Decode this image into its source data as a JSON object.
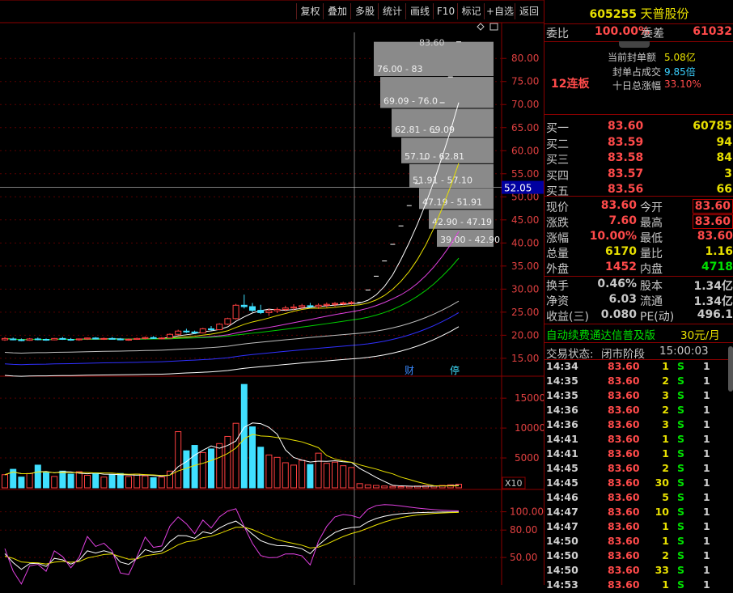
{
  "toolbar": {
    "buttons": [
      "复权",
      "叠加",
      "多股",
      "统计",
      "画线",
      "F10",
      "标记",
      "+自选",
      "返回"
    ]
  },
  "stock": {
    "code": "605255",
    "name": "天普股份"
  },
  "commission": {
    "ratio_label": "委比",
    "ratio_value": "100.00%",
    "diff_label": "委差",
    "diff_value": "61032"
  },
  "limit_info": {
    "streak": "12连板",
    "seal_amount_label": "当前封单额",
    "seal_amount_value": "5.08亿",
    "seal_ratio_label": "封单占成交",
    "seal_ratio_value": "9.85倍",
    "ten_day_label": "十日总涨幅",
    "ten_day_value": "33.10%"
  },
  "bids": [
    {
      "label": "买一",
      "price": "83.60",
      "vol": "60785"
    },
    {
      "label": "买二",
      "price": "83.59",
      "vol": "94"
    },
    {
      "label": "买三",
      "price": "83.58",
      "vol": "84"
    },
    {
      "label": "买四",
      "price": "83.57",
      "vol": "3"
    },
    {
      "label": "买五",
      "price": "83.56",
      "vol": "66"
    }
  ],
  "quote": {
    "rows": [
      [
        "现价",
        "83.60",
        "今开",
        "83.60"
      ],
      [
        "涨跌",
        "7.60",
        "最高",
        "83.60"
      ],
      [
        "涨幅",
        "10.00%",
        "最低",
        "83.60"
      ],
      [
        "总量",
        "6170",
        "量比",
        "1.16"
      ],
      [
        "外盘",
        "1452",
        "内盘",
        "4718"
      ]
    ],
    "rows2": [
      [
        "换手",
        "0.46%",
        "股本",
        "1.34亿"
      ],
      [
        "净资",
        "6.03",
        "流通",
        "1.34亿"
      ],
      [
        "收益(三)",
        "0.080",
        "PE(动)",
        "496.1"
      ]
    ]
  },
  "ad": {
    "text": "自动续费通达信普及版",
    "price": "30元/月"
  },
  "trade_status": {
    "label": "交易状态:",
    "value": "闭市阶段",
    "time": "15:00:03"
  },
  "ticks": [
    [
      "14:34",
      "83.60",
      "1",
      "S",
      "1"
    ],
    [
      "14:35",
      "83.60",
      "2",
      "S",
      "1"
    ],
    [
      "14:35",
      "83.60",
      "3",
      "S",
      "1"
    ],
    [
      "14:36",
      "83.60",
      "2",
      "S",
      "1"
    ],
    [
      "14:36",
      "83.60",
      "3",
      "S",
      "1"
    ],
    [
      "14:41",
      "83.60",
      "1",
      "S",
      "1"
    ],
    [
      "14:41",
      "83.60",
      "1",
      "S",
      "1"
    ],
    [
      "14:45",
      "83.60",
      "2",
      "S",
      "1"
    ],
    [
      "14:45",
      "83.60",
      "30",
      "S",
      "1"
    ],
    [
      "14:46",
      "83.60",
      "5",
      "S",
      "1"
    ],
    [
      "14:47",
      "83.60",
      "10",
      "S",
      "1"
    ],
    [
      "14:47",
      "83.60",
      "1",
      "S",
      "1"
    ],
    [
      "14:50",
      "83.60",
      "1",
      "S",
      "1"
    ],
    [
      "14:50",
      "83.60",
      "2",
      "S",
      "1"
    ],
    [
      "14:50",
      "83.60",
      "33",
      "S",
      "1"
    ],
    [
      "14:53",
      "83.60",
      "1",
      "S",
      "1"
    ]
  ],
  "chart_data": {
    "type": "candlestick",
    "price_axis": {
      "ticks": [
        15,
        20,
        25,
        30,
        35,
        40,
        45,
        50,
        55,
        60,
        65,
        70,
        75,
        80
      ],
      "ylim": [
        12,
        86
      ]
    },
    "crosshair_price": "52.05",
    "last_price_label": "83.60",
    "chip_ranges": [
      "39.00 - 42.90",
      "42.90 - 47.19",
      "47.19 - 51.91",
      "51.91 - 57.10",
      "57.10 - 62.81",
      "62.81 - 69.09",
      "69.09 - 76.0",
      "76.00 - 83"
    ],
    "markers": [
      "财",
      "停"
    ],
    "candles": [
      [
        19.0,
        19.6,
        18.8,
        19.3
      ],
      [
        19.2,
        19.5,
        18.9,
        19.0
      ],
      [
        19.0,
        19.3,
        18.7,
        18.9
      ],
      [
        18.9,
        19.4,
        18.8,
        19.2
      ],
      [
        19.2,
        19.5,
        18.9,
        19.1
      ],
      [
        19.1,
        19.3,
        18.8,
        19.0
      ],
      [
        19.0,
        19.4,
        18.9,
        19.3
      ],
      [
        19.3,
        19.6,
        19.0,
        19.1
      ],
      [
        19.1,
        19.4,
        18.8,
        19.0
      ],
      [
        19.0,
        19.3,
        18.8,
        19.2
      ],
      [
        19.2,
        19.5,
        19.0,
        19.4
      ],
      [
        19.4,
        19.6,
        19.1,
        19.2
      ],
      [
        19.2,
        19.5,
        19.0,
        19.3
      ],
      [
        19.3,
        19.6,
        19.1,
        19.2
      ],
      [
        19.2,
        19.4,
        18.9,
        19.0
      ],
      [
        19.0,
        19.3,
        18.8,
        19.1
      ],
      [
        19.1,
        19.5,
        19.0,
        19.3
      ],
      [
        19.3,
        19.7,
        19.1,
        19.5
      ],
      [
        19.5,
        19.8,
        19.2,
        19.3
      ],
      [
        19.3,
        19.6,
        19.1,
        19.4
      ],
      [
        19.4,
        20.4,
        19.3,
        20.2
      ],
      [
        20.2,
        21.2,
        20.0,
        20.9
      ],
      [
        20.9,
        21.4,
        20.5,
        20.7
      ],
      [
        20.7,
        21.0,
        20.3,
        20.5
      ],
      [
        20.5,
        21.6,
        20.4,
        21.4
      ],
      [
        21.4,
        22.0,
        21.0,
        21.2
      ],
      [
        21.2,
        22.6,
        21.1,
        22.4
      ],
      [
        22.4,
        23.8,
        22.2,
        23.6
      ],
      [
        23.6,
        26.8,
        23.4,
        26.5
      ],
      [
        26.5,
        28.8,
        25.8,
        26.2
      ],
      [
        26.2,
        27.0,
        25.0,
        25.4
      ],
      [
        25.4,
        26.6,
        24.6,
        24.9
      ],
      [
        24.9,
        25.8,
        24.2,
        25.3
      ],
      [
        25.3,
        26.0,
        24.8,
        25.6
      ],
      [
        25.6,
        26.4,
        25.2,
        25.9
      ],
      [
        25.9,
        26.7,
        25.4,
        26.1
      ],
      [
        26.1,
        26.8,
        25.6,
        26.4
      ],
      [
        26.4,
        27.0,
        25.9,
        26.2
      ],
      [
        26.2,
        26.9,
        25.7,
        26.5
      ],
      [
        26.5,
        27.1,
        26.0,
        26.7
      ],
      [
        26.7,
        27.2,
        26.2,
        26.9
      ],
      [
        26.9,
        27.3,
        26.5,
        27.0
      ],
      [
        27.0,
        27.4,
        26.6,
        27.1
      ],
      [
        27.1,
        27.1,
        27.1,
        27.1
      ],
      [
        29.8,
        29.8,
        29.8,
        29.8
      ],
      [
        32.8,
        32.8,
        32.8,
        32.8
      ],
      [
        36.1,
        36.1,
        36.1,
        36.1
      ],
      [
        39.7,
        39.7,
        39.7,
        39.7
      ],
      [
        43.7,
        43.7,
        43.7,
        43.7
      ],
      [
        48.1,
        48.1,
        48.1,
        48.1
      ],
      [
        52.9,
        52.9,
        52.9,
        52.9
      ],
      [
        58.2,
        58.2,
        58.2,
        58.2
      ],
      [
        64.0,
        64.0,
        64.0,
        64.0
      ],
      [
        70.4,
        70.4,
        70.4,
        70.4
      ],
      [
        76.0,
        76.0,
        76.0,
        76.0
      ],
      [
        83.6,
        83.6,
        83.6,
        83.6
      ]
    ],
    "volume_axis": {
      "ticks": [
        5000,
        10000,
        15000
      ],
      "ylim": [
        0,
        18000
      ],
      "unit_label": "X10"
    },
    "volumes": [
      2200,
      3100,
      1800,
      2400,
      3800,
      2600,
      1900,
      2800,
      2300,
      2700,
      2100,
      2500,
      1800,
      2200,
      2400,
      1900,
      2300,
      2000,
      1700,
      1800,
      2800,
      9400,
      6200,
      7100,
      5900,
      6500,
      7400,
      8600,
      10800,
      17300,
      10200,
      6800,
      5500,
      5100,
      4200,
      3800,
      4600,
      3900,
      5800,
      4100,
      4300,
      3700,
      3400,
      700,
      500,
      400,
      300,
      250,
      200,
      250,
      300,
      350,
      300,
      400,
      500,
      600
    ],
    "indicator_axis": {
      "ticks": [
        50,
        80,
        100
      ],
      "ylim": [
        20,
        120
      ]
    }
  }
}
